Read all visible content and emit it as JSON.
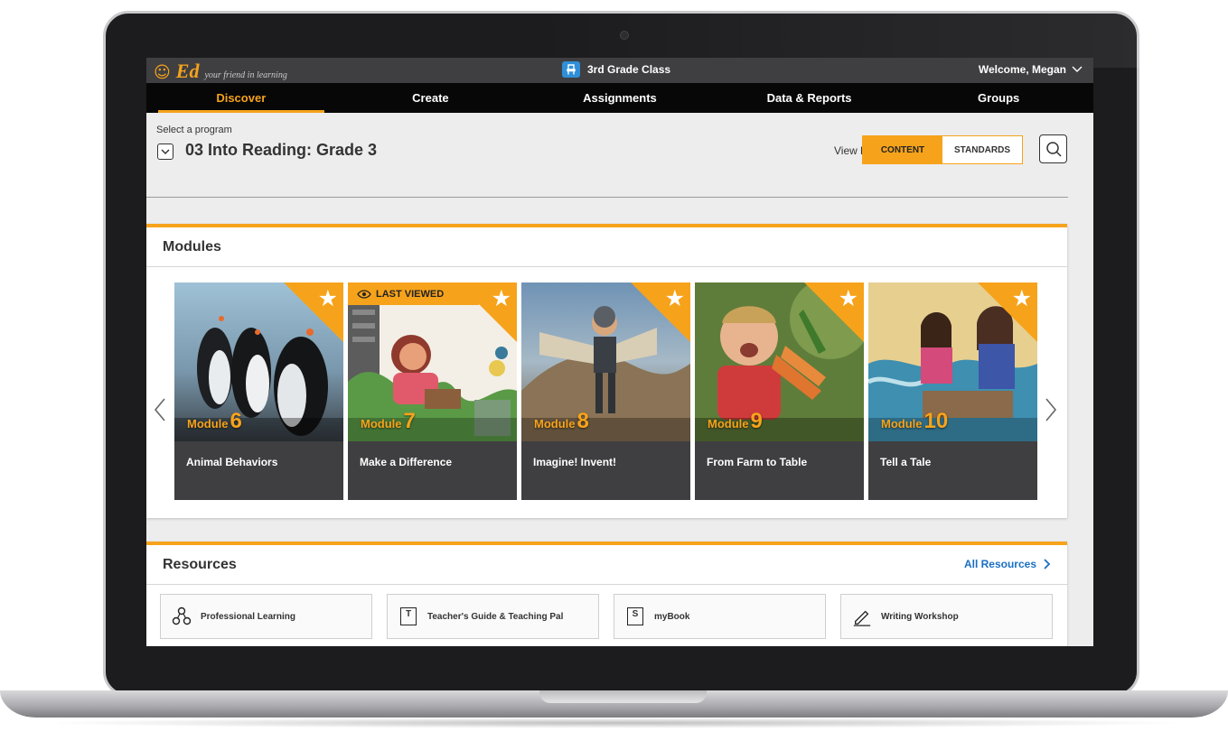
{
  "header": {
    "logo_mark": "☺",
    "logo_text": "Ed",
    "tagline": "your friend in learning",
    "class_name": "3rd Grade Class",
    "welcome": "Welcome, Megan"
  },
  "nav": {
    "items": [
      {
        "label": "Discover",
        "active": true
      },
      {
        "label": "Create",
        "active": false
      },
      {
        "label": "Assignments",
        "active": false
      },
      {
        "label": "Data & Reports",
        "active": false
      },
      {
        "label": "Groups",
        "active": false
      }
    ]
  },
  "program": {
    "label": "Select a program",
    "title": "03 Into Reading: Grade 3",
    "view_by_label": "View by",
    "view_options": [
      "CONTENT",
      "STANDARDS"
    ],
    "selected_view": "CONTENT"
  },
  "modules": {
    "title": "Modules",
    "last_viewed_label": "LAST VIEWED",
    "module_word": "Module",
    "cards": [
      {
        "number": "6",
        "title": "Animal Behaviors"
      },
      {
        "number": "7",
        "title": "Make a Difference",
        "last_viewed": true
      },
      {
        "number": "8",
        "title": "Imagine! Invent!"
      },
      {
        "number": "9",
        "title": "From Farm to Table"
      },
      {
        "number": "10",
        "title": "Tell a Tale"
      }
    ]
  },
  "resources": {
    "title": "Resources",
    "all_link": "All Resources",
    "items": [
      {
        "label": "Professional Learning",
        "icon": "people-network-icon"
      },
      {
        "label": "Teacher's Guide & Teaching Pal",
        "icon": "book-t-icon",
        "glyph": "T"
      },
      {
        "label": "myBook",
        "icon": "book-s-icon",
        "glyph": "S"
      },
      {
        "label": "Writing Workshop",
        "icon": "pencil-icon"
      }
    ]
  },
  "colors": {
    "accent": "#f6a31b",
    "nav_bg": "#070707",
    "topbar_bg": "#3f3f41",
    "link": "#1a6fc4"
  }
}
